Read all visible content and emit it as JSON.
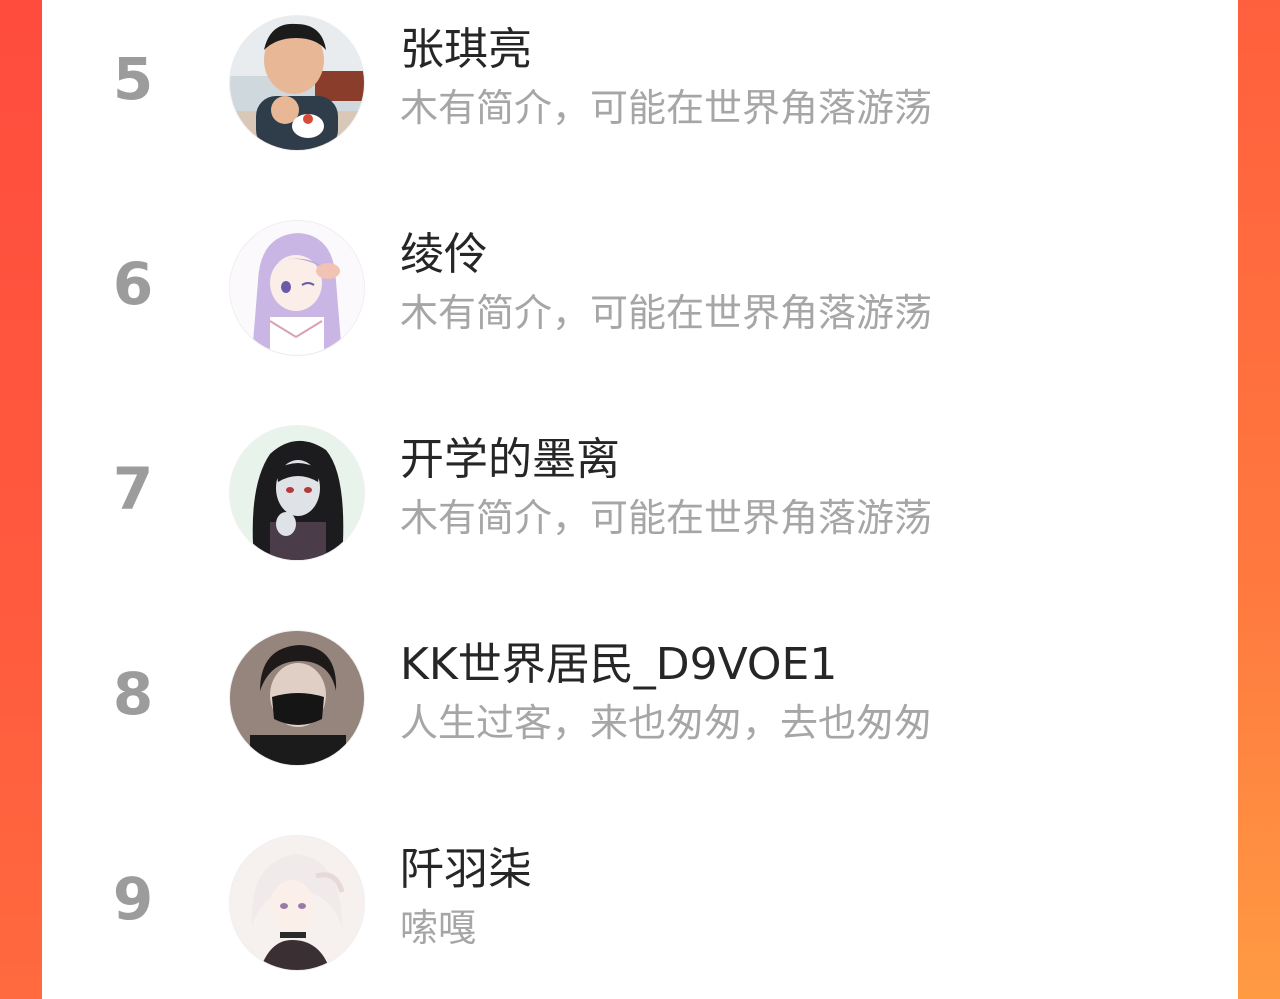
{
  "ranking": {
    "rows": [
      {
        "rank": "5",
        "name": "张琪亮",
        "bio": "木有简介，可能在世界角落游荡",
        "avatar_icon": "boy-photo-avatar"
      },
      {
        "rank": "6",
        "name": "绫伶",
        "bio": "木有简介，可能在世界角落游荡",
        "avatar_icon": "anime-girl-lavender-hair-avatar"
      },
      {
        "rank": "7",
        "name": "开学的墨离",
        "bio": "木有简介，可能在世界角落游荡",
        "avatar_icon": "anime-dark-hair-avatar"
      },
      {
        "rank": "8",
        "name": "KK世界居民_D9VOE1",
        "bio": "人生过客，来也匆匆，去也匆匆",
        "avatar_icon": "masked-person-avatar"
      },
      {
        "rank": "9",
        "name": "阡羽柒",
        "bio": "嗦嘎",
        "avatar_icon": "anime-white-hair-avatar"
      }
    ]
  },
  "colors": {
    "panel_bg": "#ffffff",
    "rank_text": "#9c9c9c",
    "name_text": "#262626",
    "bio_text": "#a6a6a6",
    "frame_gradient_top": "#ff5a3a",
    "frame_gradient_bottom": "#ff8a3e"
  }
}
